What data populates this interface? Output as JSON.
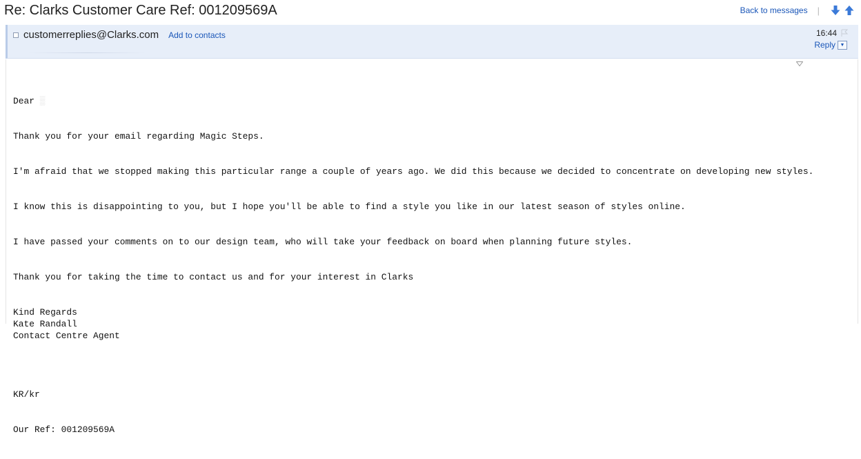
{
  "subject": "Re: Clarks Customer Care Ref: 001209569A",
  "nav": {
    "back_label": "Back to messages",
    "separator": "|",
    "next_icon": "arrow-down-icon",
    "prev_icon": "arrow-up-icon"
  },
  "header": {
    "sender": "customerreplies@Clarks.com",
    "add_contacts": "Add to contacts",
    "time": "16:44",
    "reply_label": "Reply",
    "reply_dropdown_glyph": "▼",
    "flag_icon": "flag-icon"
  },
  "message": {
    "greeting": "Dear",
    "para1": "Thank you for your email regarding Magic Steps.",
    "para2": "I'm afraid that we stopped making this particular range a couple of years ago. We did this because we decided to concentrate on developing new styles.",
    "para3": "I know this is disappointing to you, but I hope you'll be able to find a style you like in our latest season of styles online.",
    "para4": "I have passed your comments on to our design team, who will take your feedback on board when planning future styles.",
    "para5": "Thank you for taking the time to contact us and for your interest in Clarks",
    "sign_regards": "Kind Regards",
    "sign_name": "Kate Randall",
    "sign_title": "Contact Centre Agent",
    "initials": "KR/kr",
    "ref": "Our Ref: 001209569A"
  },
  "colors": {
    "link": "#1a56b8",
    "header_bg": "#e7eef9",
    "arrow_blue": "#3b7ad8"
  }
}
